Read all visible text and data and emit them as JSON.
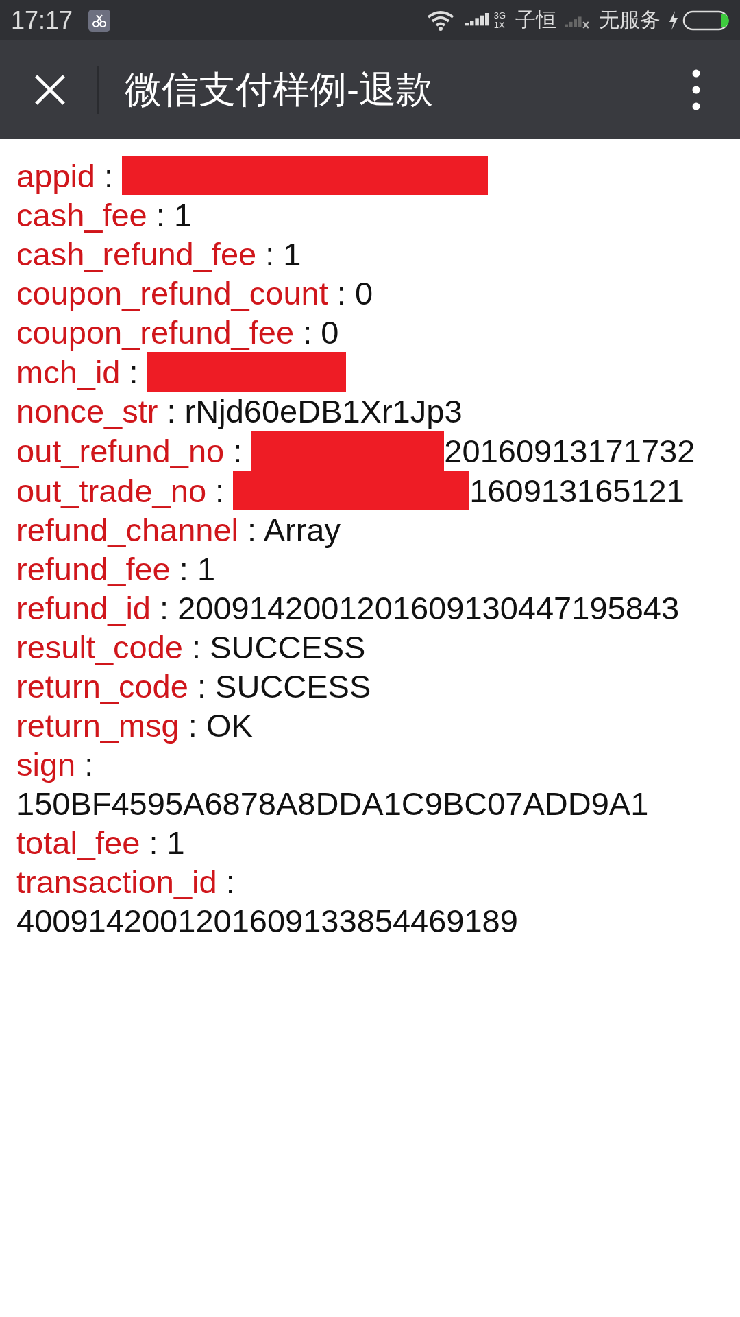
{
  "status_bar": {
    "time": "17:17",
    "network_type_top": "3G",
    "network_type_bottom": "1X",
    "carrier": "子恒",
    "service": "无服务"
  },
  "title_bar": {
    "title": "微信支付样例-退款"
  },
  "fields": [
    {
      "key": "appid",
      "separator": ":",
      "redacted": true
    },
    {
      "key": "cash_fee",
      "separator": ":",
      "value": "1",
      "redacted": false
    },
    {
      "key": "cash_refund_fee",
      "separator": ":",
      "value": "1",
      "redacted": false
    },
    {
      "key": "coupon_refund_count",
      "separator": ":",
      "value": "0",
      "redacted": false
    },
    {
      "key": "coupon_refund_fee",
      "separator": ":",
      "value": "0",
      "redacted": false
    },
    {
      "key": "mch_id",
      "separator": ":",
      "redacted": true
    },
    {
      "key": "nonce_str",
      "separator": ":",
      "value": "rNjd60eDB1Xr1Jp3",
      "redacted": false
    },
    {
      "key": "out_refund_no",
      "separator": ":",
      "value": "20160913171732",
      "redacted": true
    },
    {
      "key": "out_trade_no",
      "separator": ":",
      "value": "160913165121",
      "redacted": true
    },
    {
      "key": "refund_channel",
      "separator": ":",
      "value": "Array",
      "redacted": false
    },
    {
      "key": "refund_fee",
      "separator": ":",
      "value": "1",
      "redacted": false
    },
    {
      "key": "refund_id",
      "separator": ":",
      "value": "2009142001201609130447195843",
      "redacted": false
    },
    {
      "key": "result_code",
      "separator": ":",
      "value": "SUCCESS",
      "redacted": false
    },
    {
      "key": "return_code",
      "separator": ":",
      "value": "SUCCESS",
      "redacted": false
    },
    {
      "key": "return_msg",
      "separator": ":",
      "value": "OK",
      "redacted": false
    },
    {
      "key": "sign",
      "separator": ":",
      "value": "150BF4595A6878A8DDA1C9BC07ADD9A1",
      "redacted": false
    },
    {
      "key": "total_fee",
      "separator": ":",
      "value": "1",
      "redacted": false
    },
    {
      "key": "transaction_id",
      "separator": ":",
      "value": "4009142001201609133854469189",
      "redacted": false
    }
  ]
}
